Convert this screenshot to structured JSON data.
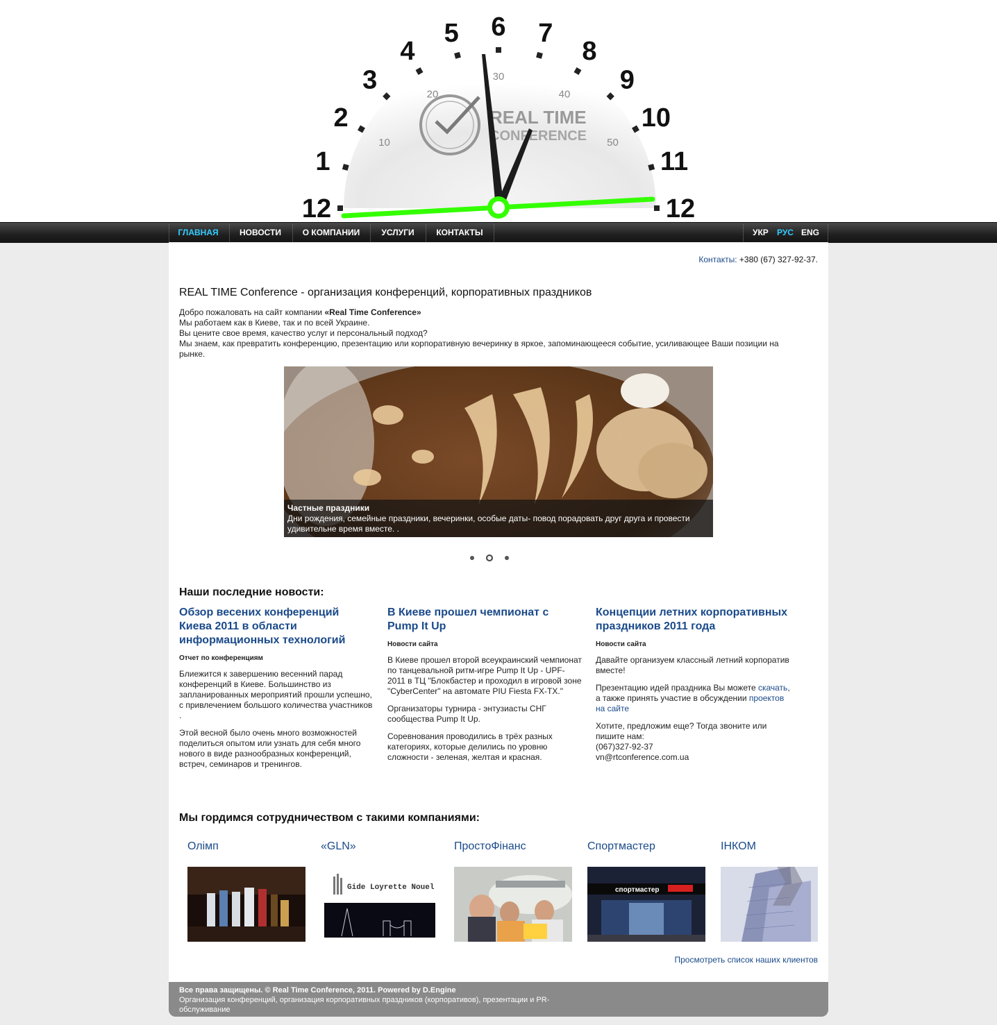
{
  "header": {
    "logo_line1": "REAL TIME",
    "logo_line2": "CONFERENCE",
    "hour_numbers": [
      "12",
      "1",
      "2",
      "3",
      "4",
      "5",
      "6",
      "7",
      "8",
      "9",
      "10",
      "11",
      "12"
    ],
    "minute_numbers": [
      "10",
      "20",
      "30",
      "40",
      "50"
    ],
    "accent_color": "#33ff00"
  },
  "nav": {
    "items": [
      {
        "label": "ГЛАВНАЯ",
        "active": true
      },
      {
        "label": "НОВОСТИ"
      },
      {
        "label": "О КОМПАНИИ"
      },
      {
        "label": "УСЛУГИ"
      },
      {
        "label": "КОНТАКТЫ"
      }
    ],
    "langs": [
      {
        "label": "УКР"
      },
      {
        "label": "РУС",
        "active": true
      },
      {
        "label": "ENG"
      }
    ],
    "active_color": "#33ccff"
  },
  "contacts": {
    "label": "Контакты:",
    "phone": "+380 (67) 327-92-37",
    "suffix": "."
  },
  "main": {
    "title": "REAL TIME Conference - организация конференций, корпоративных праздников",
    "intro_prefix": "Добро пожаловать на сайт компании ",
    "intro_company": "«Real Time Conference»",
    "intro_lines": [
      "Мы работаем как в Киеве, так и по всей Украине.",
      "Вы цените свое время, качество услуг и персональный подход?",
      "Мы знаем, как превратить конференцию, презентацию или корпоративную вечеринку в яркое, запоминающееся событие, усиливающее Ваши позиции на рынке."
    ]
  },
  "slider": {
    "caption_title": "Частные праздники",
    "caption_text": "Дни рождения, семейные праздники, вечеринки, особые даты- повод порадовать друг друга и провести удивительне время вместе. .",
    "active_slide": 2,
    "slide_count": 3
  },
  "news": {
    "heading": "Наши последние новости:",
    "items": [
      {
        "title": "Обзор весених конференций Киева 2011 в области информационных технологий",
        "category": "Отчет по конференциям",
        "paragraphs": [
          "Блиежится к завершению весенний парад конференций в Киеве. Большинство из запланированных мероприятий прошли успешно, с привлечением большого количества участников .",
          "Этой весной было очень много возможностей поделиться опытом или узнать для себя много нового в виде разнообразных конференций, встреч, семинаров и тренингов."
        ]
      },
      {
        "title": "В Киеве прошел чемпионат с Pump It Up",
        "category": "Новости сайта",
        "paragraphs": [
          "В Киеве прошел второй всеукраинский чемпионат по танцевальной ритм-игре Pump It Up - UPF-2011 в ТЦ \"Блокбастер и проходил в игровой зоне \"CyberCenter\" на автомате PIU Fiesta FX-TX.\"",
          "Организаторы турнира - энтузиасты СНГ сообщества Pump It Up.",
          "Соревнования проводились в трёх разных категориях, которые делились по уровню сложности - зеленая, желтая и красная."
        ]
      },
      {
        "title": "Концепции летних корпоративных праздников 2011 года",
        "category": "Новости сайта",
        "p1": "Давайте организуем классный летний корпоратив вместе!",
        "p2_a": "Презентацию идей праздника Вы можете ",
        "p2_link1": "скачать",
        "p2_b": ", а также принять участие в обсуждении ",
        "p2_link2": "проектов на сайте",
        "p3_lines": [
          "Хотите, предложим еще? Тогда звоните или пишите нам:",
          "(067)327-92-37",
          "vn@rtconference.com.ua"
        ]
      }
    ]
  },
  "partners": {
    "heading": "Мы гордимся сотрудничеством с такими компаниями:",
    "items": [
      {
        "name": "Олімп"
      },
      {
        "name": "«GLN»",
        "logo_text": "Gide Loyrette Nouel"
      },
      {
        "name": "ПростоФінанс"
      },
      {
        "name": "Спортмастер",
        "sign_text": "спортмастер"
      },
      {
        "name": "ІНКОМ"
      }
    ],
    "clients_link": "Просмотреть список наших клиентов"
  },
  "footer": {
    "line1": "Все права защищены. © Real Time Conference, 2011. Powered by D.Engine",
    "line2": "Организация конференций, организация корпоративных праздников (корпоративов), презентации и PR-обслуживание"
  }
}
